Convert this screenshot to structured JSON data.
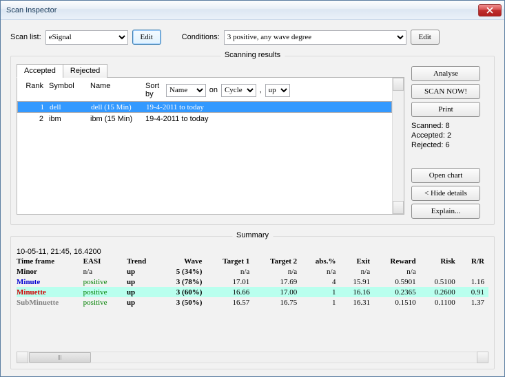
{
  "title": "Scan Inspector",
  "toolbar": {
    "scan_list_label": "Scan list:",
    "scan_list_value": "eSignal",
    "edit1": "Edit",
    "conditions_label": "Conditions:",
    "conditions_value": "3 positive, any wave degree",
    "edit2": "Edit"
  },
  "results": {
    "legend": "Scanning results",
    "tabs": {
      "accepted": "Accepted",
      "rejected": "Rejected"
    },
    "headers": {
      "rank": "Rank",
      "symbol": "Symbol",
      "name": "Name",
      "sort_label": "Sort by",
      "sort_field": "Name",
      "on": "on",
      "cycle": "Cycle",
      "dir": "up"
    },
    "rows": [
      {
        "rank": "1",
        "symbol": "dell",
        "name": "dell (15 Min)",
        "range": "19-4-2011 to today",
        "selected": true
      },
      {
        "rank": "2",
        "symbol": "ibm",
        "name": "ibm (15 Min)",
        "range": "19-4-2011 to today",
        "selected": false
      }
    ],
    "side": {
      "analyse": "Analyse",
      "scan": "SCAN NOW!",
      "print": "Print",
      "scanned": "Scanned: 8",
      "accepted": "Accepted: 2",
      "rejected": "Rejected: 6",
      "open_chart": "Open chart",
      "hide_details": "< Hide details",
      "explain": "Explain..."
    }
  },
  "summary": {
    "legend": "Summary",
    "meta": "10-05-11, 21:45, 16.4200",
    "headers": [
      "Time frame",
      "EASI",
      "Trend",
      "Wave",
      "Target 1",
      "Target 2",
      "abs.%",
      "Exit",
      "Reward",
      "Risk",
      "R/R"
    ],
    "rows": [
      {
        "tf": "Minor",
        "tfcls": "c-black",
        "easi": "n/a",
        "easicls": "",
        "trend": "up",
        "wave": "5 (34%)",
        "t1": "n/a",
        "t2": "n/a",
        "abs": "n/a",
        "exit": "n/a",
        "rew": "n/a",
        "risk": "",
        "rr": "",
        "hl": false
      },
      {
        "tf": "Minute",
        "tfcls": "c-blue",
        "easi": "positive",
        "easicls": "c-green",
        "trend": "up",
        "wave": "3 (78%)",
        "t1": "17.01",
        "t2": "17.69",
        "abs": "4",
        "exit": "15.91",
        "rew": "0.5901",
        "risk": "0.5100",
        "rr": "1.16",
        "hl": false
      },
      {
        "tf": "Minuette",
        "tfcls": "c-red",
        "easi": "positive",
        "easicls": "c-green",
        "trend": "up",
        "wave": "3 (60%)",
        "t1": "16.66",
        "t2": "17.00",
        "abs": "1",
        "exit": "16.16",
        "rew": "0.2365",
        "risk": "0.2600",
        "rr": "0.91",
        "hl": true
      },
      {
        "tf": "SubMinuette",
        "tfcls": "c-gray",
        "easi": "positive",
        "easicls": "c-green",
        "trend": "up",
        "wave": "3 (50%)",
        "t1": "16.57",
        "t2": "16.75",
        "abs": "1",
        "exit": "16.31",
        "rew": "0.1510",
        "risk": "0.1100",
        "rr": "1.37",
        "hl": false
      }
    ]
  }
}
